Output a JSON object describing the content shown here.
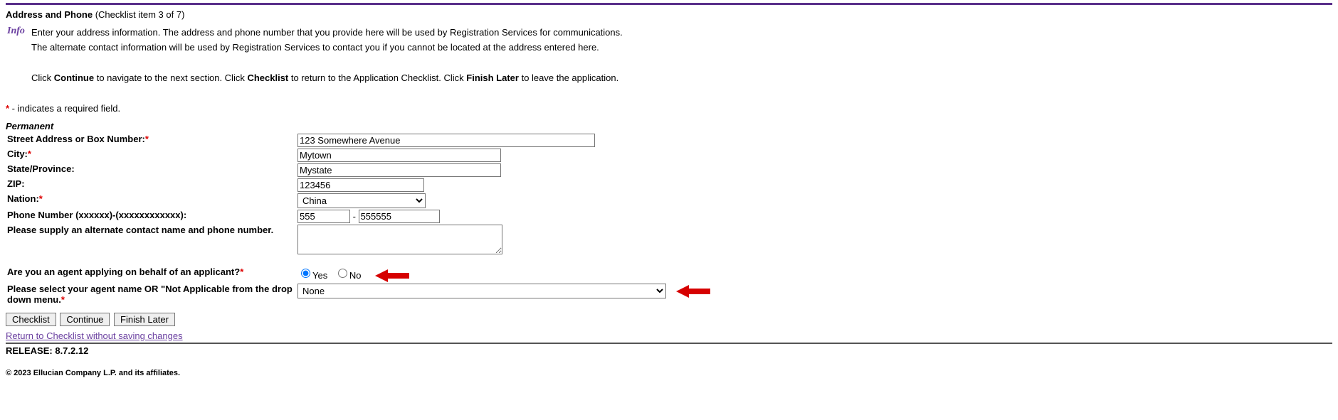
{
  "header": {
    "title": "Address and Phone",
    "subtitle": " (Checklist item 3 of 7)"
  },
  "info": {
    "label": "Info",
    "line1": "Enter your address information. The address and phone number that you provide here will be used by Registration Services for communications.",
    "line2": "The alternate contact information will be used by Registration Services to contact you if you cannot be located at the address entered here."
  },
  "nav_instr": {
    "p1": "Click ",
    "b1": "Continue",
    "p2": " to navigate to the next section. Click ",
    "b2": "Checklist",
    "p3": " to return to the Application Checklist. Click ",
    "b3": "Finish Later",
    "p4": " to leave the application."
  },
  "req_note": {
    "text": " - indicates a required field."
  },
  "section": "Permanent",
  "labels": {
    "street": "Street Address or Box Number:",
    "city": "City:",
    "state": "State/Province:",
    "zip": "ZIP:",
    "nation": "Nation:",
    "phone": "Phone Number (xxxxxx)-(xxxxxxxxxxxx):",
    "alt_contact": "Please supply an alternate contact name and phone number.",
    "agent_q": "Are you an agent applying on behalf of an applicant?",
    "agent_select": "Please select your agent name OR \"Not Applicable from the drop down menu.",
    "phone_sep": " - "
  },
  "values": {
    "street": "123 Somewhere Avenue",
    "city": "Mytown",
    "state": "Mystate",
    "zip": "123456",
    "nation": "China",
    "phone_a": "555",
    "phone_b": "555555",
    "alt_contact": "",
    "yes": "Yes",
    "no": "No",
    "agent_select": "None"
  },
  "buttons": {
    "checklist": "Checklist",
    "continue": "Continue",
    "finish_later": "Finish Later"
  },
  "return_link": "Return to Checklist without saving changes",
  "release": "RELEASE: 8.7.2.12",
  "copyright": "© 2023 Ellucian Company L.P. and its affiliates."
}
